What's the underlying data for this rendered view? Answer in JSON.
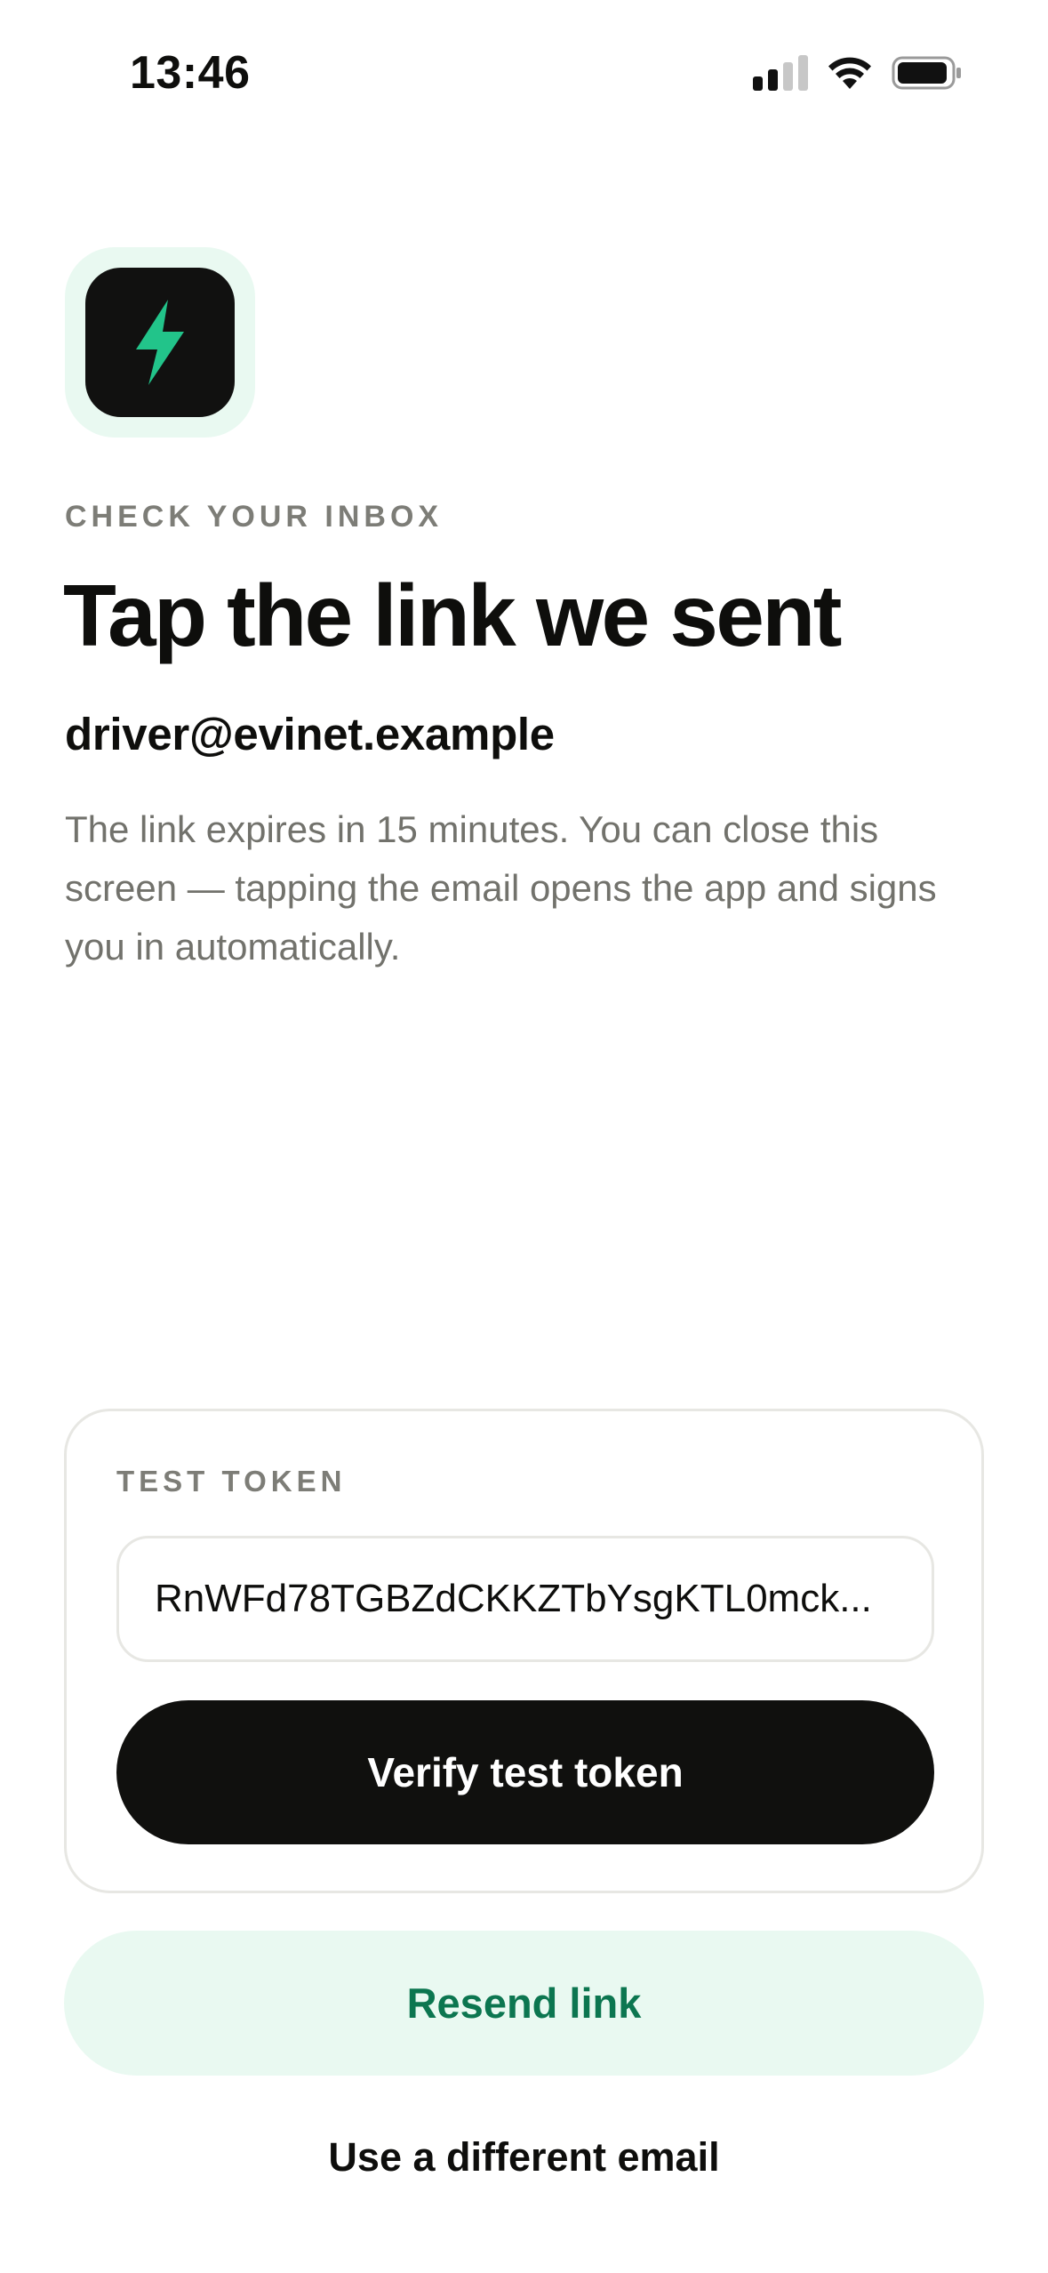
{
  "status_bar": {
    "time": "13:46",
    "icons": [
      "cellular-signal-icon",
      "wifi-icon",
      "battery-icon"
    ]
  },
  "app_icon": {
    "icon": "lightning-bolt-icon",
    "accent_color": "#22c48a",
    "tile_color": "#111110",
    "halo_color": "#e9f9f1"
  },
  "header": {
    "eyebrow": "CHECK YOUR INBOX",
    "title": "Tap the link we sent",
    "email": "driver@evinet.example",
    "description": "The link expires in 15 minutes. You can close this screen — tapping the email opens the app and signs you in automatically."
  },
  "test_token": {
    "label": "TEST TOKEN",
    "value": "RnWFd78TGBZdCKKZTbYsgKTL0mck...",
    "verify_label": "Verify test token"
  },
  "actions": {
    "resend_label": "Resend link",
    "resend_color": "#0c7650",
    "different_email_label": "Use a different email"
  }
}
